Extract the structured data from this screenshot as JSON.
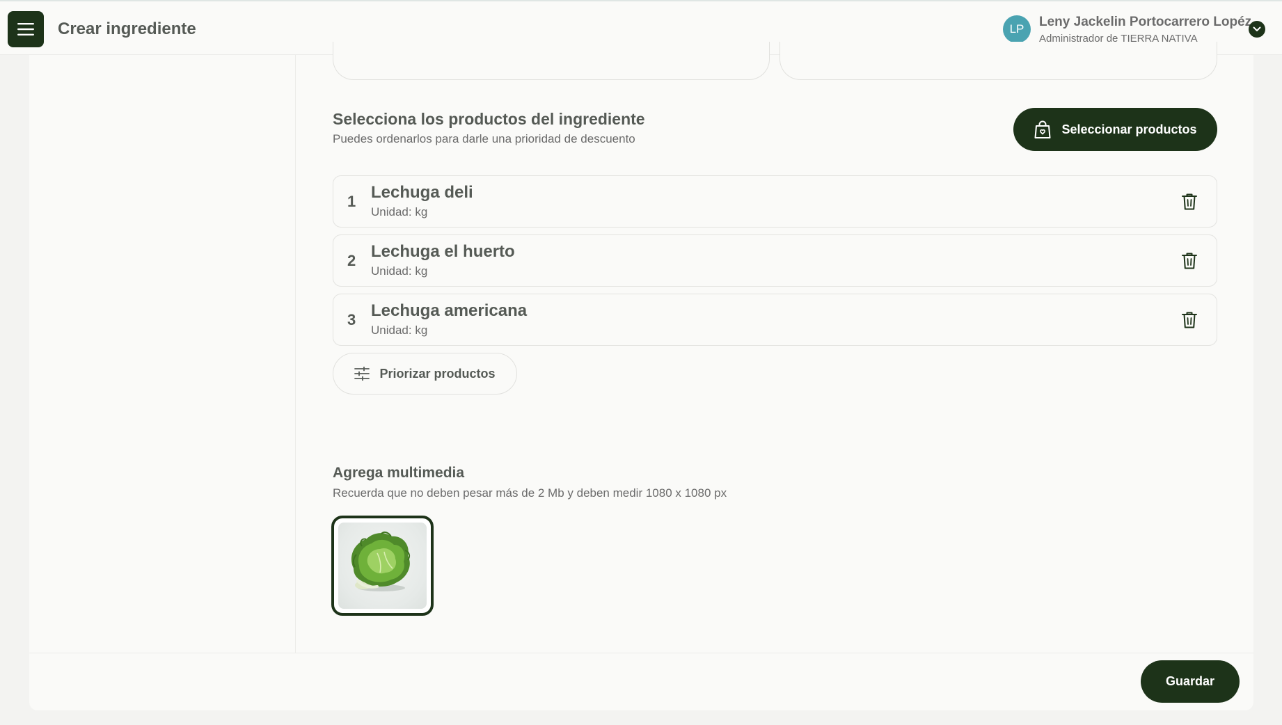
{
  "header": {
    "title": "Crear ingrediente",
    "user": {
      "initials": "LP",
      "name": "Leny Jackelin Portocarrero Lopéz",
      "role": "Administrador de TIERRA NATIVA"
    }
  },
  "products_section": {
    "title": "Selecciona los productos del ingrediente",
    "subtitle": "Puedes ordenarlos para darle una prioridad de descuento",
    "select_button": "Seleccionar productos",
    "items": [
      {
        "index": "1",
        "name": "Lechuga deli",
        "unit": "Unidad: kg"
      },
      {
        "index": "2",
        "name": "Lechuga el huerto",
        "unit": "Unidad: kg"
      },
      {
        "index": "3",
        "name": "Lechuga americana",
        "unit": "Unidad: kg"
      }
    ],
    "prioritize_button": "Priorizar productos"
  },
  "media_section": {
    "title": "Agrega multimedia",
    "subtitle": "Recuerda que no deben pesar más de 2 Mb y deben medir 1080 x 1080 px"
  },
  "footer": {
    "save_button": "Guardar"
  },
  "colors": {
    "primary": "#1d3319",
    "avatar": "#4aa3b1",
    "background": "#fafaf8"
  }
}
